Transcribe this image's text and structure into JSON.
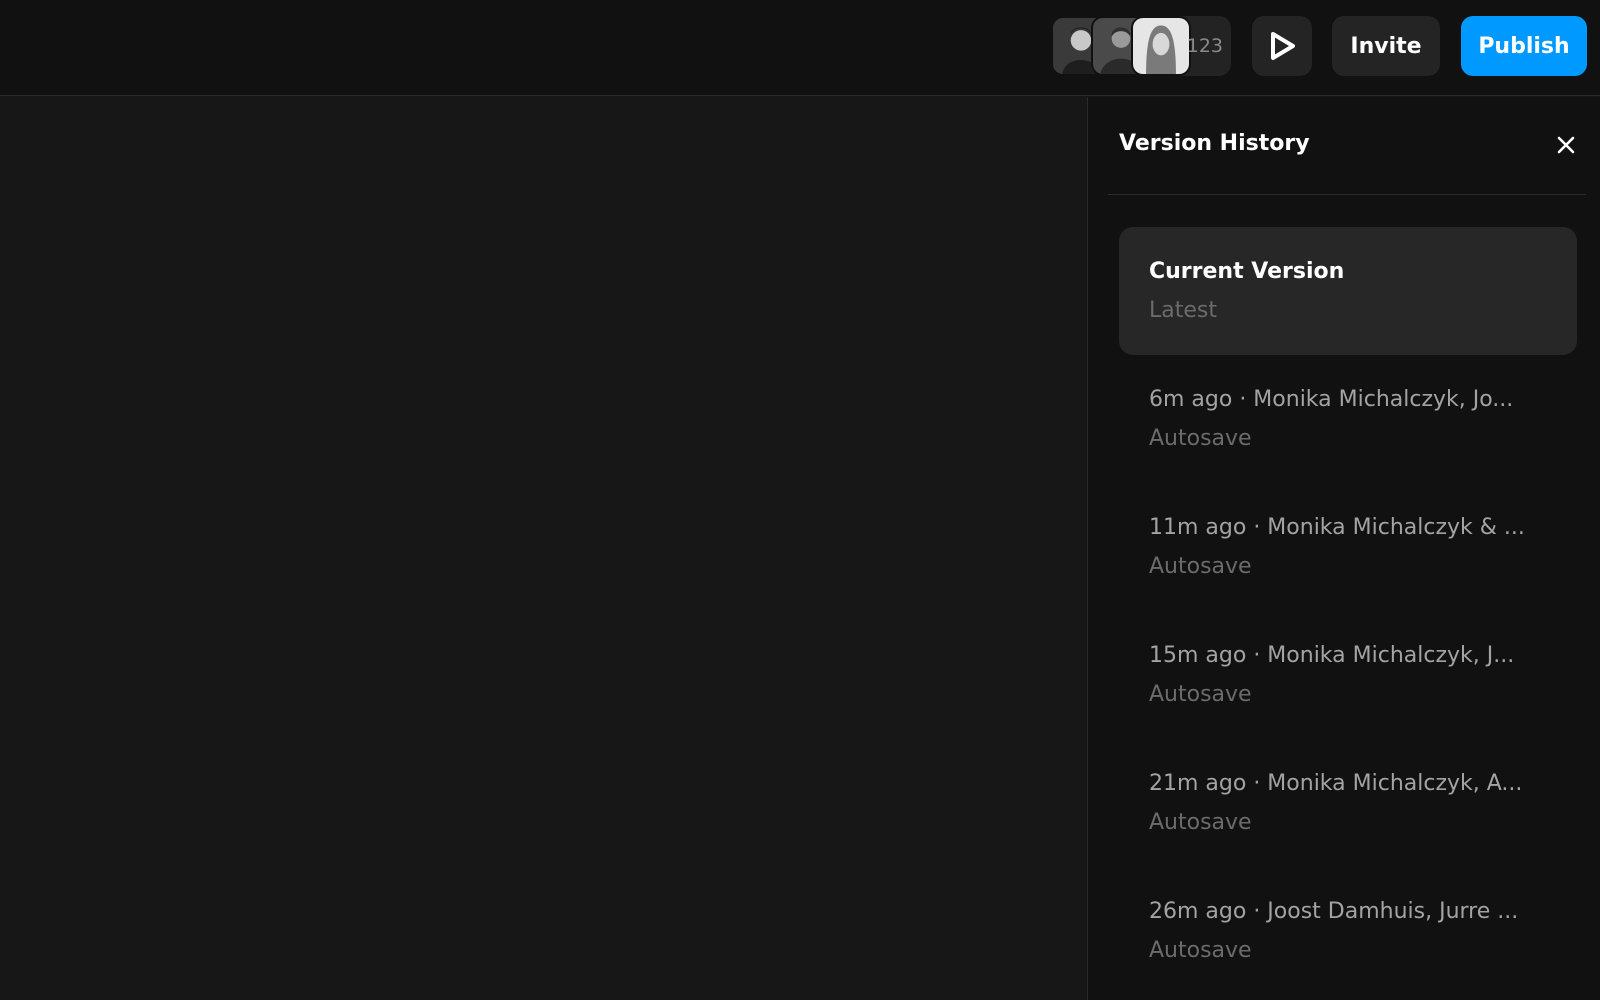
{
  "topbar": {
    "collaborators": {
      "count_label": "123",
      "avatars": [
        {
          "name": "avatar-1"
        },
        {
          "name": "avatar-2"
        },
        {
          "name": "avatar-3"
        }
      ]
    },
    "play_icon": "play-icon",
    "invite_label": "Invite",
    "publish_label": "Publish",
    "colors": {
      "publish": "#0099ff",
      "button_bg": "#242424",
      "bar_bg": "#111111"
    }
  },
  "panel": {
    "title": "Version History",
    "close_icon": "close-icon",
    "versions": [
      {
        "title": "Current Version",
        "subtitle": "Latest"
      },
      {
        "title": "6m ago · Monika Michalczyk, Jo...",
        "subtitle": "Autosave"
      },
      {
        "title": "11m ago · Monika Michalczyk & ...",
        "subtitle": "Autosave"
      },
      {
        "title": "15m ago · Monika Michalczyk, J...",
        "subtitle": "Autosave"
      },
      {
        "title": "21m ago · Monika Michalczyk, A...",
        "subtitle": "Autosave"
      },
      {
        "title": "26m ago · Joost Damhuis, Jurre ...",
        "subtitle": "Autosave"
      }
    ]
  }
}
